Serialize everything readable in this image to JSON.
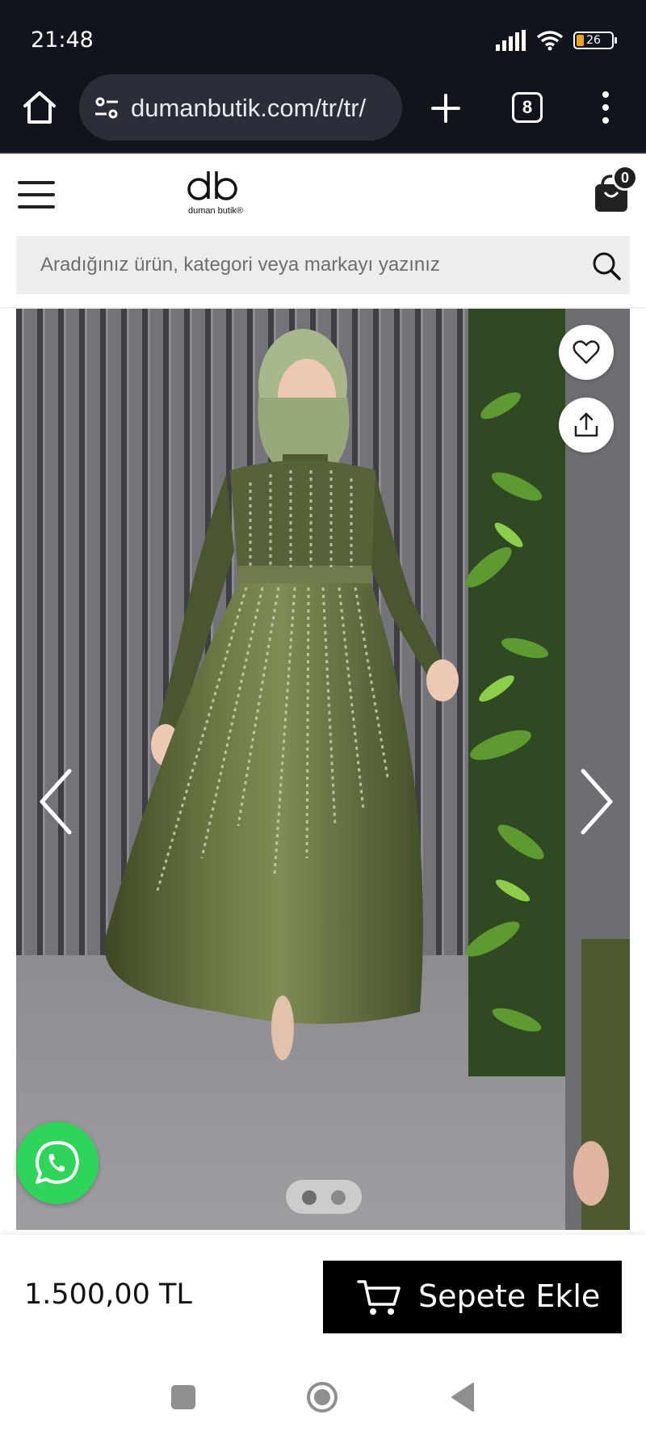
{
  "status_bar": {
    "time": "21:48",
    "battery_level": "26"
  },
  "browser": {
    "url": "dumanbutik.com/tr/tr/",
    "tab_count": "8"
  },
  "site": {
    "logo_alt": "duman butik",
    "cart_count": "0"
  },
  "search": {
    "placeholder": "Aradığınız ürün, kategori veya markayı yazınız"
  },
  "product": {
    "price": "1.500,00 TL",
    "add_to_cart_label": "Sepete Ekle",
    "gallery_total": 2,
    "gallery_active": 1
  },
  "colors": {
    "chrome_bg": "#12141d",
    "whatsapp": "#2fd55a",
    "button_bg": "#000000",
    "dress": "#5c6a3a"
  }
}
